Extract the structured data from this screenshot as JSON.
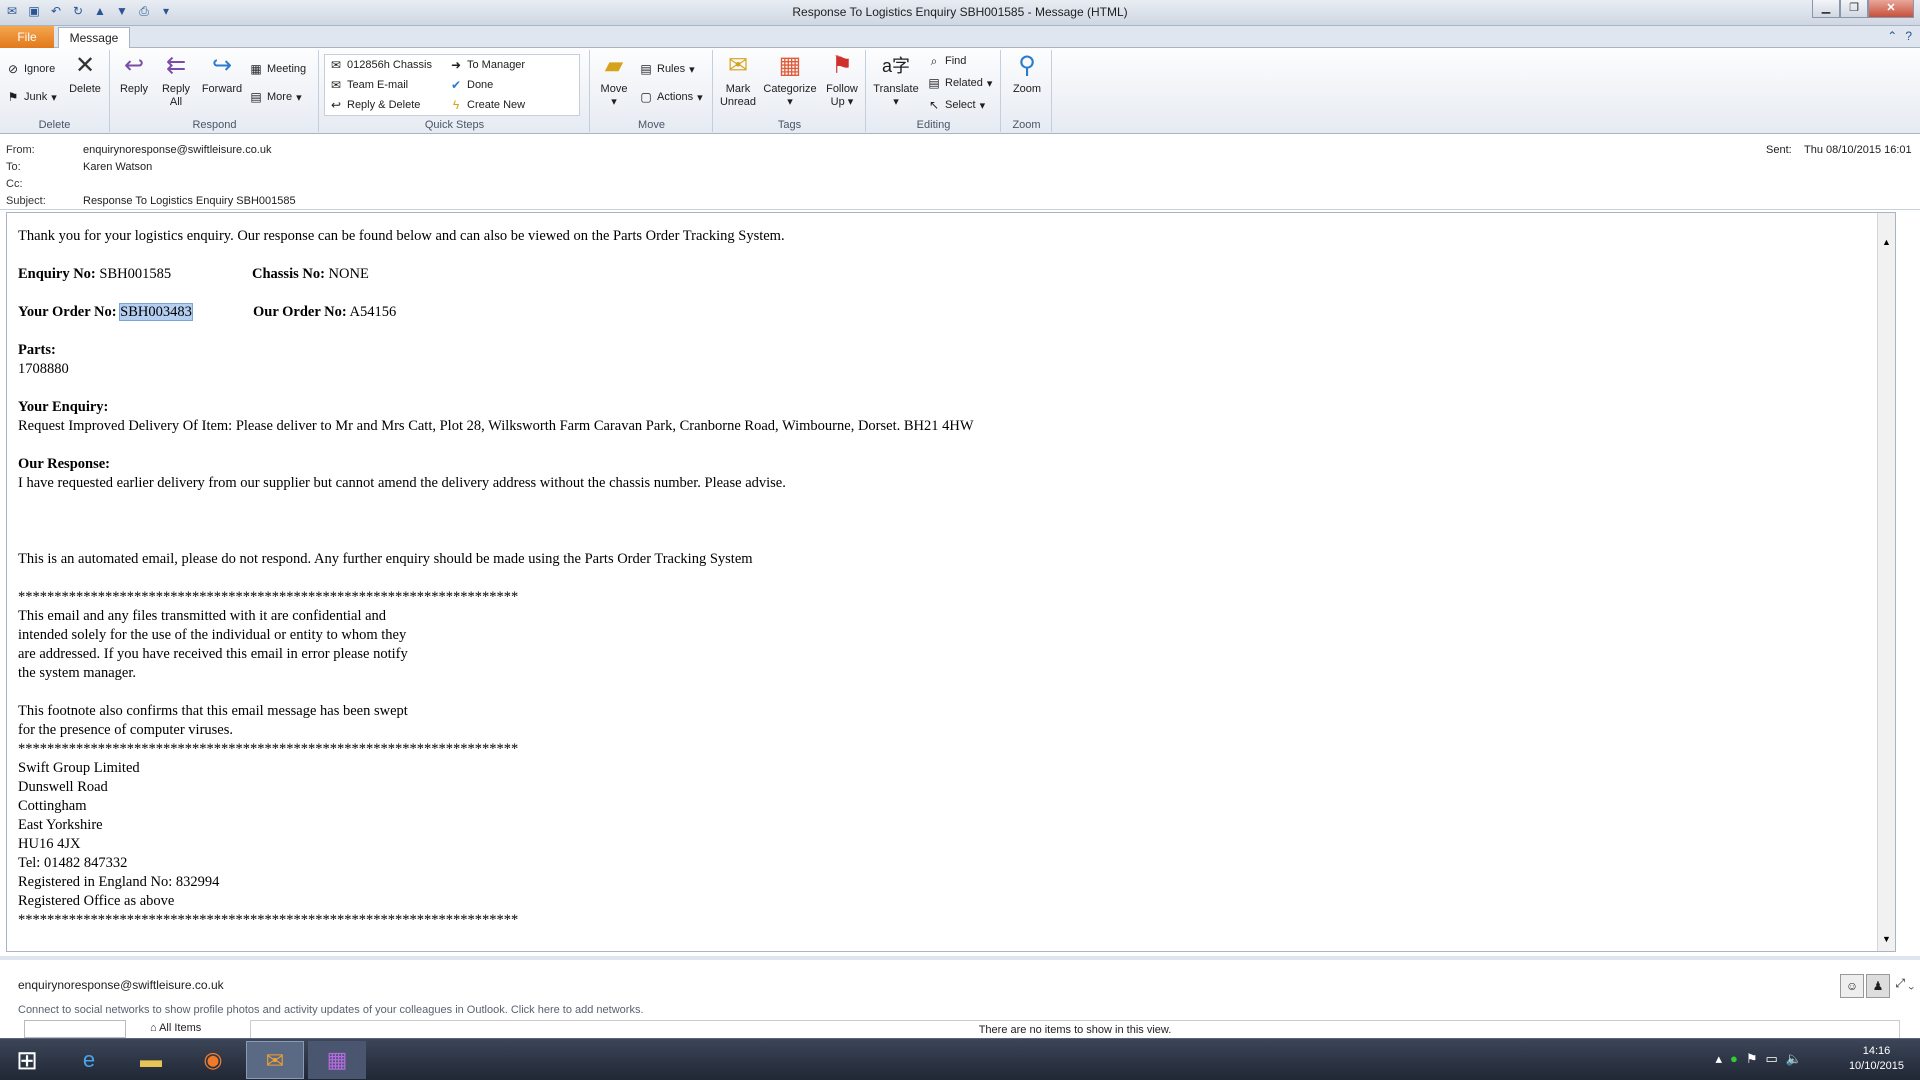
{
  "window": {
    "title": "Response To Logistics Enquiry SBH001585 - Message (HTML)"
  },
  "tabs": {
    "file": "File",
    "message": "Message"
  },
  "ribbon": {
    "delete": {
      "label": "Delete",
      "ignore": "Ignore",
      "junk": "Junk",
      "delete": "Delete"
    },
    "respond": {
      "label": "Respond",
      "reply": "Reply",
      "reply_all": "Reply\nAll",
      "reply_all_l1": "Reply",
      "reply_all_l2": "All",
      "forward": "Forward",
      "meeting": "Meeting",
      "more": "More"
    },
    "quicksteps": {
      "label": "Quick Steps",
      "items": [
        "012856h Chassis",
        "To Manager",
        "Team E-mail",
        "Done",
        "Reply & Delete",
        "Create New"
      ]
    },
    "move": {
      "label": "Move",
      "move": "Move",
      "rules": "Rules",
      "actions": "Actions"
    },
    "tags": {
      "label": "Tags",
      "mark_unread_l1": "Mark",
      "mark_unread_l2": "Unread",
      "categorize": "Categorize",
      "follow_l1": "Follow",
      "follow_l2": "Up"
    },
    "editing": {
      "label": "Editing",
      "translate": "Translate",
      "find": "Find",
      "related": "Related",
      "select": "Select"
    },
    "zoom": {
      "label": "Zoom",
      "zoom": "Zoom"
    }
  },
  "header": {
    "from_k": "From:",
    "from": "enquirynoresponse@swiftleisure.co.uk",
    "to_k": "To:",
    "to": "Karen Watson",
    "cc_k": "Cc:",
    "subject_k": "Subject:",
    "subject": "Response To Logistics Enquiry SBH001585",
    "sent_k": "Sent:",
    "sent": "Thu 08/10/2015 16:01"
  },
  "message": {
    "intro": "Thank you for your logistics enquiry. Our response can be found below and can also be viewed on the Parts Order Tracking System.",
    "enquiry_k": "Enquiry No:",
    "enquiry": "SBH001585",
    "chassis_k": "Chassis No:",
    "chassis": "NONE",
    "your_order_k": "Your Order No:",
    "your_order": "SBH003483",
    "our_order_k": "Our Order No:",
    "our_order": "A54156",
    "parts_k": "Parts:",
    "parts": "1708880",
    "your_enquiry_k": "Your Enquiry:",
    "your_enquiry": "Request Improved Delivery Of Item: Please deliver to Mr and Mrs Catt, Plot 28, Wilksworth Farm Caravan Park, Cranborne Road, Wimbourne, Dorset. BH21 4HW",
    "our_response_k": "Our Response:",
    "our_response": "I have requested earlier delivery from our supplier but cannot amend the delivery address without the chassis number. Please advise.",
    "automated": "This is an automated email, please do not respond. Any further enquiry should be made using the Parts Order Tracking System",
    "stars": "*********************************************************************",
    "conf1": "This email and any files transmitted with it are confidential and",
    "conf2": "intended solely for the use of the individual or entity to whom they",
    "conf3": "are addressed. If you have received this email in error please notify",
    "conf4": "the system manager.",
    "foot1": "This footnote also confirms that this email message has been swept",
    "foot2": "for the presence of computer viruses.",
    "addr": [
      "Swift Group Limited",
      "Dunswell Road",
      "Cottingham",
      "East Yorkshire",
      "HU16 4JX",
      "Tel: 01482 847332",
      "Registered in England No: 832994",
      "Registered Office as above"
    ]
  },
  "people": {
    "email": "enquirynoresponse@swiftleisure.co.uk",
    "connect": "Connect to social networks to show profile photos and activity updates of your colleagues in Outlook. Click here to add networks.",
    "all_items": "All Items",
    "no_items": "There are no items to show in this view."
  },
  "taskbar": {
    "time": "14:16",
    "date": "10/10/2015"
  }
}
